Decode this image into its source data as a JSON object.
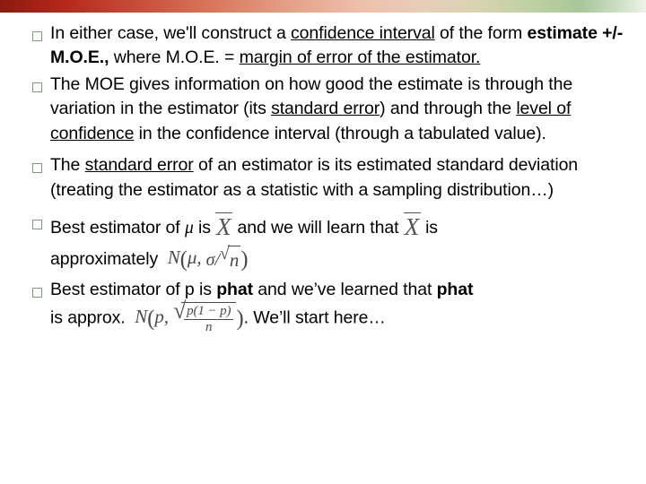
{
  "slide": {
    "top_bar_colors": [
      "#8b1a0f",
      "#c8503a",
      "#e5a189",
      "#bcd0a0",
      "#eef3ea"
    ],
    "bullet_marker": "hollow-square",
    "bullets": [
      {
        "id": "bullet-1",
        "parts": [
          {
            "t": "In either case, we'll construct a ",
            "style": "plain"
          },
          {
            "t": "confidence interval",
            "style": "underline"
          },
          {
            "t": " of the form  ",
            "style": "plain"
          },
          {
            "t": "estimate +/- M.O.E.,",
            "style": "bold"
          },
          {
            "t": "  where  M.O.E. = ",
            "style": "plain"
          },
          {
            "t": "margin of error of the estimator.",
            "style": "underline"
          }
        ]
      },
      {
        "id": "bullet-2",
        "parts": [
          {
            "t": "The MOE gives information on how good the estimate is through the variation in the estimator (its ",
            "style": "plain"
          },
          {
            "t": "standard error",
            "style": "underline"
          },
          {
            "t": ") and through the ",
            "style": "plain"
          },
          {
            "t": "level of confidence",
            "style": "underline"
          },
          {
            "t": " in the confidence interval (through a tabulated value).",
            "style": "plain"
          }
        ]
      },
      {
        "id": "bullet-3",
        "parts": [
          {
            "t": "The ",
            "style": "plain"
          },
          {
            "t": "standard error",
            "style": "underline"
          },
          {
            "t": " of an estimator is its estimated standard deviation (treating the estimator as a statistic with a sampling distribution…)",
            "style": "plain"
          }
        ]
      },
      {
        "id": "bullet-4",
        "line1_a": "Best estimator of ",
        "line1_mu": "μ",
        "line1_b": " is",
        "line1_math1": "X",
        "line1_c": "and we will learn that",
        "line1_math2": "X",
        "line1_d": "is",
        "line2_a": "approximately",
        "line2_math": {
          "fn": "N",
          "mean": "μ",
          "sigma": "σ",
          "over": "/",
          "radicand": "n"
        }
      },
      {
        "id": "bullet-5",
        "line1_a": "Best estimator of  p is ",
        "line1_b": "phat",
        "line1_c": " and we’ve learned that ",
        "line1_d": "phat",
        "line2_a": "is approx.",
        "line2_math": {
          "fn": "N",
          "mean": "p",
          "num": "p(1 − p)",
          "den": "n"
        },
        "line2_b": ".  We’ll start here…"
      }
    ]
  }
}
